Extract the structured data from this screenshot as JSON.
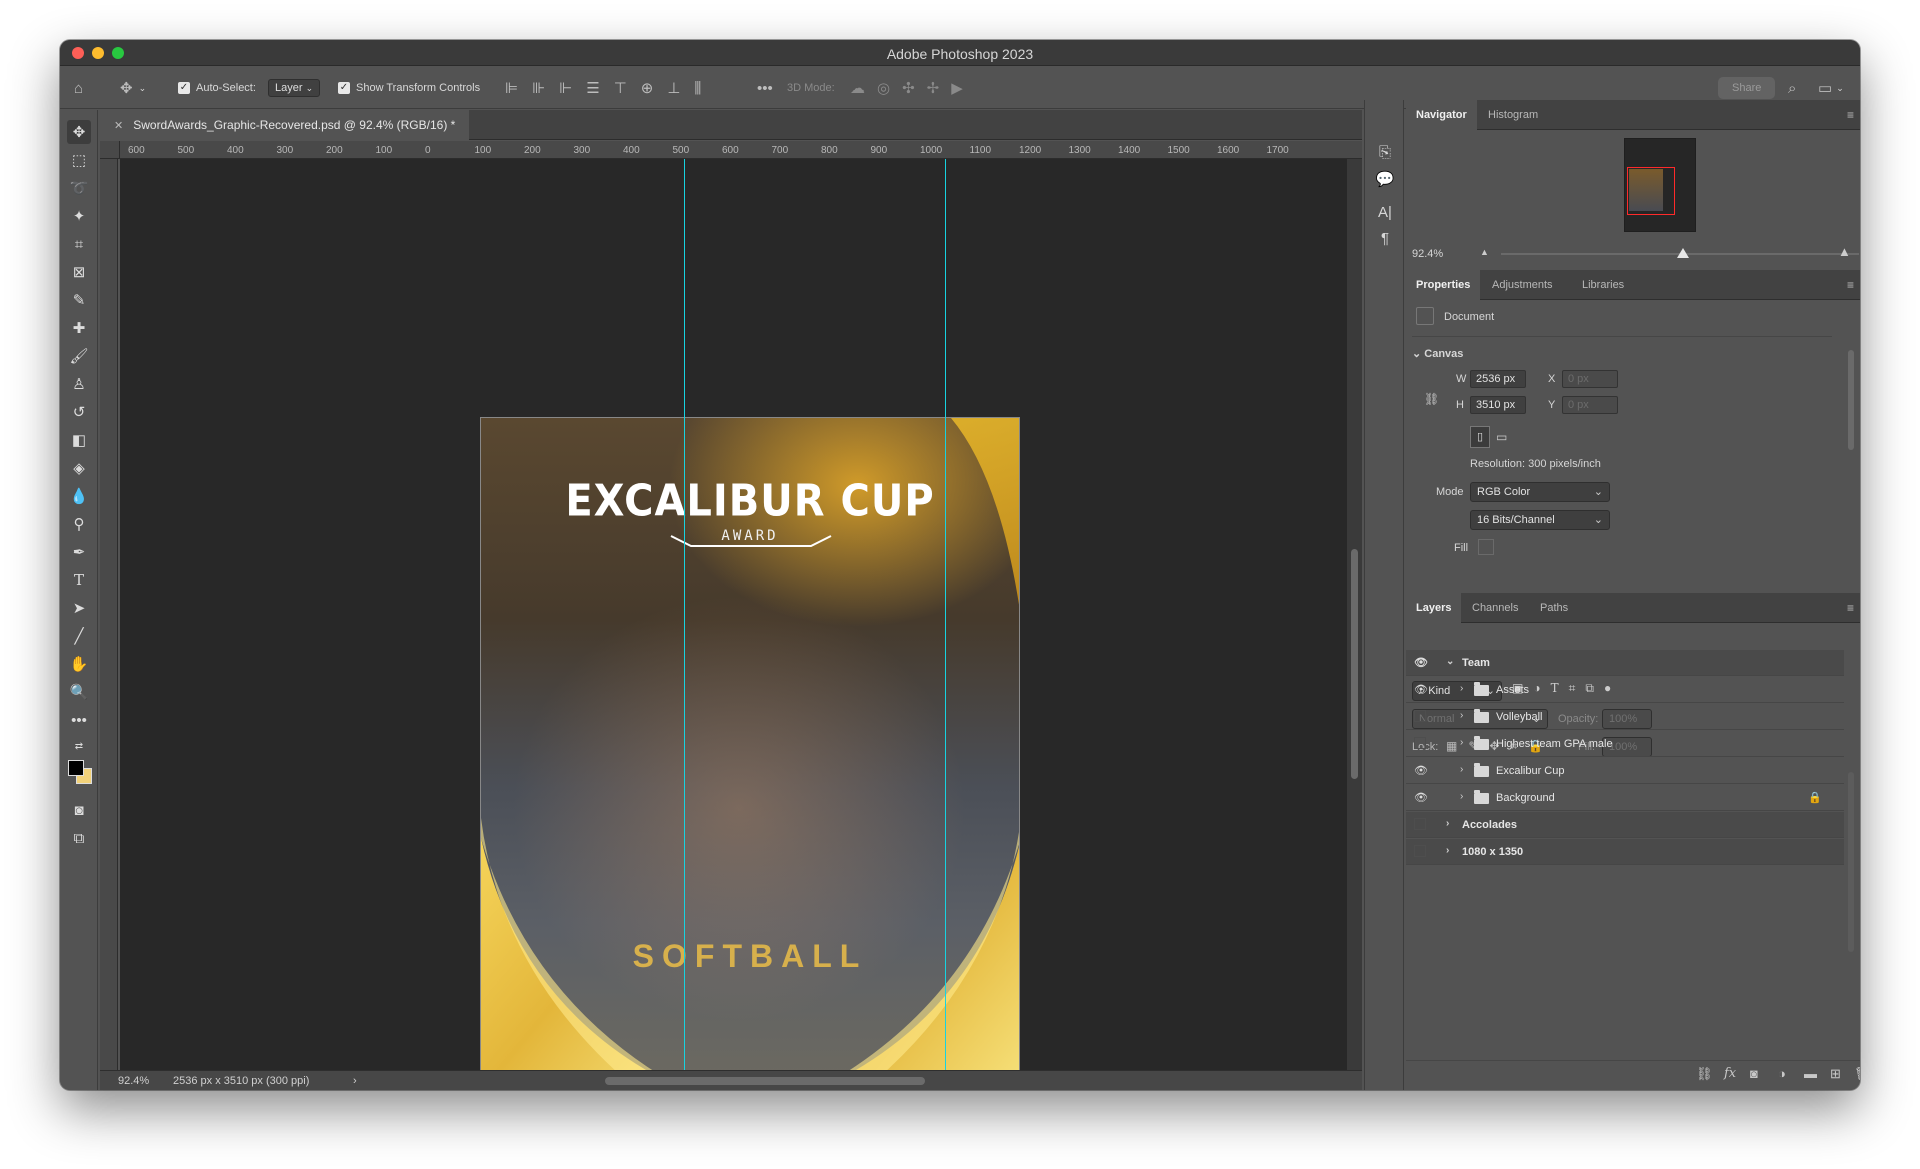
{
  "window": {
    "title": "Adobe Photoshop 2023"
  },
  "options_bar": {
    "auto_select_label": "Auto-Select:",
    "auto_select_value": "Layer",
    "show_transform_label": "Show Transform Controls",
    "three_d_mode_label": "3D Mode:",
    "share_label": "Share"
  },
  "document": {
    "tab_title": "SwordAwards_Graphic-Recovered.psd @ 92.4% (RGB/16) *",
    "ruler_ticks": [
      "600",
      "500",
      "400",
      "300",
      "200",
      "100",
      "0",
      "100",
      "200",
      "300",
      "400",
      "500",
      "600",
      "700",
      "800",
      "900",
      "1000",
      "1100",
      "1200",
      "1300",
      "1400",
      "1500",
      "1600",
      "1700"
    ],
    "artwork_title": "EXCALIBUR CUP",
    "artwork_subtitle": "AWARD",
    "artwork_sport": "SOFTBALL",
    "colors": {
      "gold": "#d7b04c",
      "guide": "#18d3e0"
    }
  },
  "status_bar": {
    "zoom": "92.4%",
    "doc_info": "2536 px x 3510 px (300 ppi)"
  },
  "navigator": {
    "tabs": [
      "Navigator",
      "Histogram"
    ],
    "zoom": "92.4%"
  },
  "properties": {
    "tabs": [
      "Properties",
      "Adjustments",
      "Libraries"
    ],
    "document_label": "Document",
    "canvas_label": "Canvas",
    "w_label": "W",
    "w_value": "2536 px",
    "h_label": "H",
    "h_value": "3510 px",
    "x_label": "X",
    "x_placeholder": "0 px",
    "y_label": "Y",
    "y_placeholder": "0 px",
    "resolution": "Resolution: 300 pixels/inch",
    "mode_label": "Mode",
    "mode_value": "RGB Color",
    "bits_value": "16 Bits/Channel",
    "fill_label": "Fill"
  },
  "layers_panel": {
    "tabs": [
      "Layers",
      "Channels",
      "Paths"
    ],
    "kind_label": "Kind",
    "blend_mode": "Normal",
    "opacity_label": "Opacity:",
    "opacity_value": "100%",
    "lock_label": "Lock:",
    "fill_label": "Fill:",
    "fill_value": "100%",
    "layers": [
      {
        "name": "Team",
        "visible": true,
        "type": "group",
        "depth": 0
      },
      {
        "name": "Assets",
        "visible": true,
        "type": "folder",
        "depth": 1
      },
      {
        "name": "Volleyball",
        "visible": false,
        "type": "folder",
        "depth": 1
      },
      {
        "name": "Highest team GPA male",
        "visible": false,
        "type": "folder",
        "depth": 1
      },
      {
        "name": "Excalibur Cup",
        "visible": true,
        "type": "folder",
        "depth": 1
      },
      {
        "name": "Background",
        "visible": true,
        "type": "folder",
        "depth": 1,
        "locked": true
      },
      {
        "name": "Accolades",
        "visible": false,
        "type": "group",
        "depth": 0
      },
      {
        "name": "1080 x 1350",
        "visible": false,
        "type": "group",
        "depth": 0
      }
    ]
  }
}
